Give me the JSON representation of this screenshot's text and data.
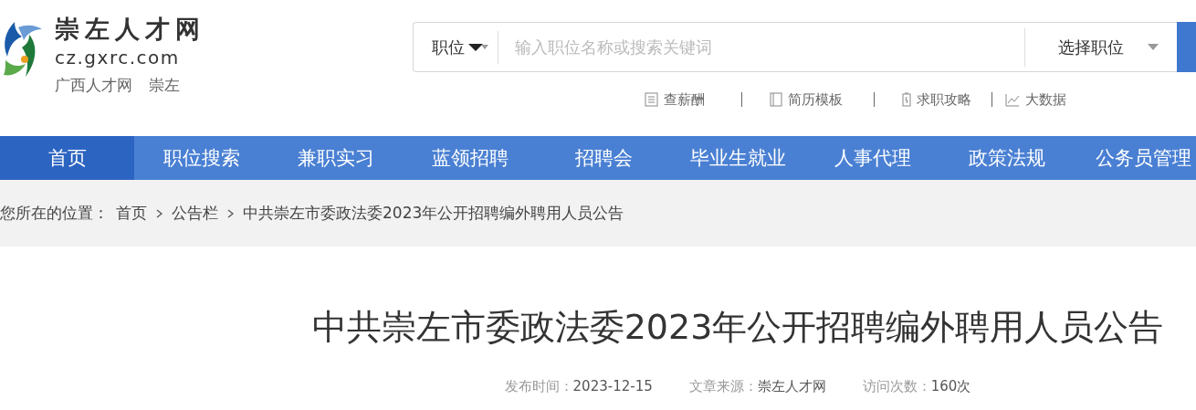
{
  "logo": {
    "name": "崇左人才网",
    "domain": "cz.gxrc.com",
    "subtitle": [
      "广西人才网",
      "崇左"
    ]
  },
  "search": {
    "category": "职位",
    "placeholder": "输入职位名称或搜索关键词",
    "position_select": "选择职位"
  },
  "quick_links": [
    {
      "kind": "salary",
      "label": "查薪酬"
    },
    {
      "kind": "resume",
      "label": "简历模板"
    },
    {
      "kind": "guide",
      "label": "求职攻略"
    },
    {
      "kind": "data",
      "label": "大数据"
    }
  ],
  "nav": [
    {
      "label": "首页",
      "selected": true
    },
    {
      "label": "职位搜索",
      "selected": false
    },
    {
      "label": "兼职实习",
      "selected": false
    },
    {
      "label": "蓝领招聘",
      "selected": false
    },
    {
      "label": "招聘会",
      "selected": false
    },
    {
      "label": "毕业生就业",
      "selected": false
    },
    {
      "label": "人事代理",
      "selected": false
    },
    {
      "label": "政策法规",
      "selected": false
    },
    {
      "label": "公务员管理",
      "selected": false
    }
  ],
  "breadcrumb": {
    "prefix": "您所在的位置：",
    "items": [
      "首页",
      "公告栏",
      "中共崇左市委政法委2023年公开招聘编外聘用人员公告"
    ]
  },
  "article": {
    "title": "中共崇左市委政法委2023年公开招聘编外聘用人员公告",
    "meta": [
      {
        "label": "发布时间：",
        "value": "2023-12-15"
      },
      {
        "label": "文章来源：",
        "value": "崇左人才网"
      },
      {
        "label": "访问次数：",
        "value": "160次"
      }
    ]
  }
}
